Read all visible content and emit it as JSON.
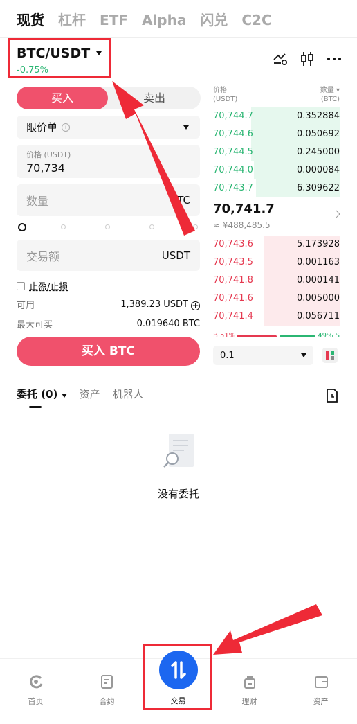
{
  "top_tabs": [
    "现货",
    "杠杆",
    "ETF",
    "Alpha",
    "闪兑",
    "C2C"
  ],
  "pair": {
    "name": "BTC/USDT",
    "change": "-0.75%"
  },
  "side": {
    "buy": "买入",
    "sell": "卖出"
  },
  "order_type": "限价单",
  "price": {
    "label": "价格 (USDT)",
    "value": "70,734"
  },
  "amount": {
    "placeholder": "数量",
    "unit": "BTC"
  },
  "slider": {
    "value": 0
  },
  "total": {
    "placeholder": "交易额",
    "unit": "USDT"
  },
  "tpsl_label": "止盈/止损",
  "available": {
    "label": "可用",
    "value": "1,389.23 USDT"
  },
  "max_buy": {
    "label": "最大可买",
    "value": "0.019640 BTC"
  },
  "buy_button": "买入 BTC",
  "orderbook": {
    "price_header": "价格",
    "price_unit": "(USDT)",
    "qty_header": "数量 ▾",
    "qty_unit": "(BTC)",
    "asks": [
      {
        "price": "70,744.7",
        "qty": "0.352884",
        "depth": 0.7
      },
      {
        "price": "70,744.6",
        "qty": "0.050692",
        "depth": 0.7
      },
      {
        "price": "70,744.5",
        "qty": "0.245000",
        "depth": 0.7
      },
      {
        "price": "70,744.0",
        "qty": "0.000084",
        "depth": 0.68
      },
      {
        "price": "70,743.7",
        "qty": "6.309622",
        "depth": 0.66
      }
    ],
    "last_price": "70,741.7",
    "fiat": "≈ ¥488,485.5",
    "bids": [
      {
        "price": "70,743.6",
        "qty": "5.173928",
        "depth": 0.6
      },
      {
        "price": "70,743.5",
        "qty": "0.001163",
        "depth": 0.6
      },
      {
        "price": "70,741.8",
        "qty": "0.000141",
        "depth": 0.6
      },
      {
        "price": "70,741.6",
        "qty": "0.005000",
        "depth": 0.6
      },
      {
        "price": "70,741.4",
        "qty": "0.056711",
        "depth": 0.6
      }
    ],
    "buy_ratio": "B 51%",
    "sell_ratio": "49% S",
    "depth_value": "0.1"
  },
  "order_tabs": [
    "委托 (0)",
    "资产",
    "机器人"
  ],
  "empty_text": "没有委托",
  "nav": [
    "首页",
    "合约",
    "交易",
    "理财",
    "资产"
  ],
  "colors": {
    "accent_red": "#f0516c",
    "green": "#2bb673",
    "blue": "#1c67f0",
    "annotation": "#ee2a37"
  }
}
